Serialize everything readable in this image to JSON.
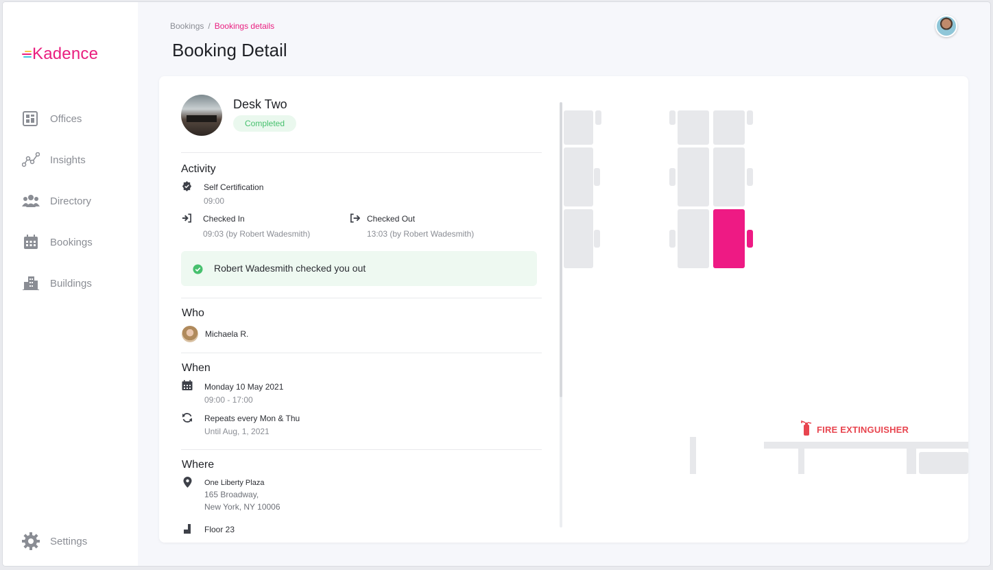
{
  "app": {
    "logo_text": "Kadence"
  },
  "sidebar": {
    "items": [
      {
        "label": "Offices",
        "icon": "building-grid-icon"
      },
      {
        "label": "Insights",
        "icon": "chart-line-icon"
      },
      {
        "label": "Directory",
        "icon": "people-icon"
      },
      {
        "label": "Bookings",
        "icon": "calendar-icon"
      },
      {
        "label": "Buildings",
        "icon": "city-icon"
      }
    ],
    "settings_label": "Settings"
  },
  "header": {
    "breadcrumb_root": "Bookings",
    "breadcrumb_sep": "/",
    "breadcrumb_current": "Bookings details",
    "title": "Booking Detail"
  },
  "desk": {
    "name": "Desk Two",
    "status": "Completed"
  },
  "activity": {
    "title": "Activity",
    "self_cert_label": "Self Certification",
    "self_cert_time": "09:00",
    "checked_in_label": "Checked In",
    "checked_in_detail": "09:03 (by Robert Wadesmith)",
    "checked_out_label": "Checked Out",
    "checked_out_detail": "13:03 (by Robert Wadesmith)",
    "alert": "Robert Wadesmith checked you out"
  },
  "who": {
    "title": "Who",
    "name": "Michaela R."
  },
  "when": {
    "title": "When",
    "date": "Monday 10 May 2021",
    "time": "09:00 - 17:00",
    "repeat": "Repeats every Mon & Thu",
    "until": "Until Aug, 1, 2021"
  },
  "where": {
    "title": "Where",
    "place": "One Liberty Plaza",
    "address1": "165 Broadway,",
    "address2": "New York, NY 10006",
    "floor": "Floor 23"
  },
  "map": {
    "fire_label": "FIRE EXTINGUISHER",
    "selected_color": "#ee1a84"
  },
  "colors": {
    "accent": "#e91e7f",
    "success": "#47c06e",
    "danger": "#e8454f"
  }
}
